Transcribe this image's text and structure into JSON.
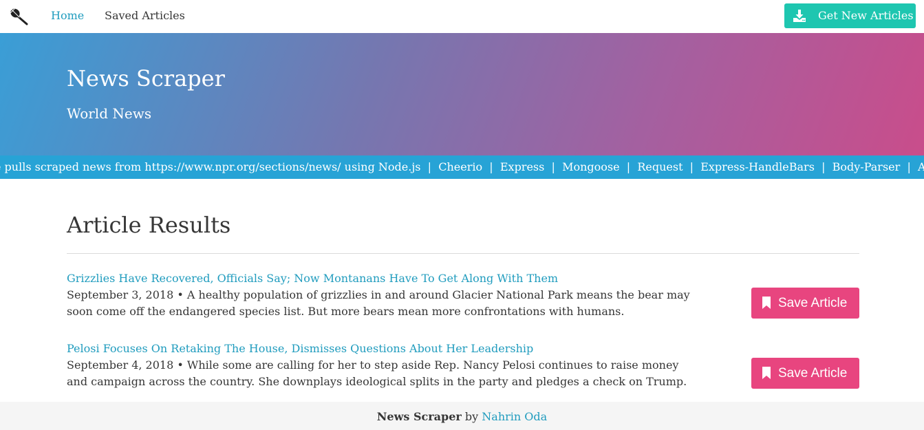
{
  "navbar": {
    "logo_icon": "microphone-icon",
    "links": [
      {
        "label": "Home",
        "active": true
      },
      {
        "label": "Saved Articles",
        "active": false
      }
    ],
    "get_articles_button": {
      "label": "Get New Articles",
      "icon": "download-icon",
      "color": "#1ec6b0"
    }
  },
  "hero": {
    "title": "News Scraper",
    "subtitle": "World News"
  },
  "ticker": {
    "text": "e pulls scraped news from https://www.npr.org/sections/news/ using Node.js  |  Cheerio  |  Express  |  Mongoose  |  Request  |  Express-HandleBars  |  Body-Parser  |  And lot's of NPM"
  },
  "results": {
    "heading": "Article Results",
    "articles": [
      {
        "title": "Grizzlies Have Recovered, Officials Say; Now Montanans Have To Get Along With Them",
        "summary": "September 3, 2018 • A healthy population of grizzlies in and around Glacier National Park means the bear may soon come off the endangered species list. But more bears mean more confrontations with humans.",
        "save_label": "Save Article"
      },
      {
        "title": "Pelosi Focuses On Retaking The House, Dismisses Questions About Her Leadership",
        "summary": "September 4, 2018 • While some are calling for her to step aside Rep. Nancy Pelosi continues to raise money and campaign across the country. She downplays ideological splits in the party and pledges a check on Trump.",
        "save_label": "Save Article"
      }
    ]
  },
  "footer": {
    "app_name": "News Scraper",
    "by": "by",
    "author": "Nahrin Oda"
  },
  "colors": {
    "accent": "#209cbe",
    "save_button": "#e8457f",
    "ticker": "#27a3d6"
  }
}
